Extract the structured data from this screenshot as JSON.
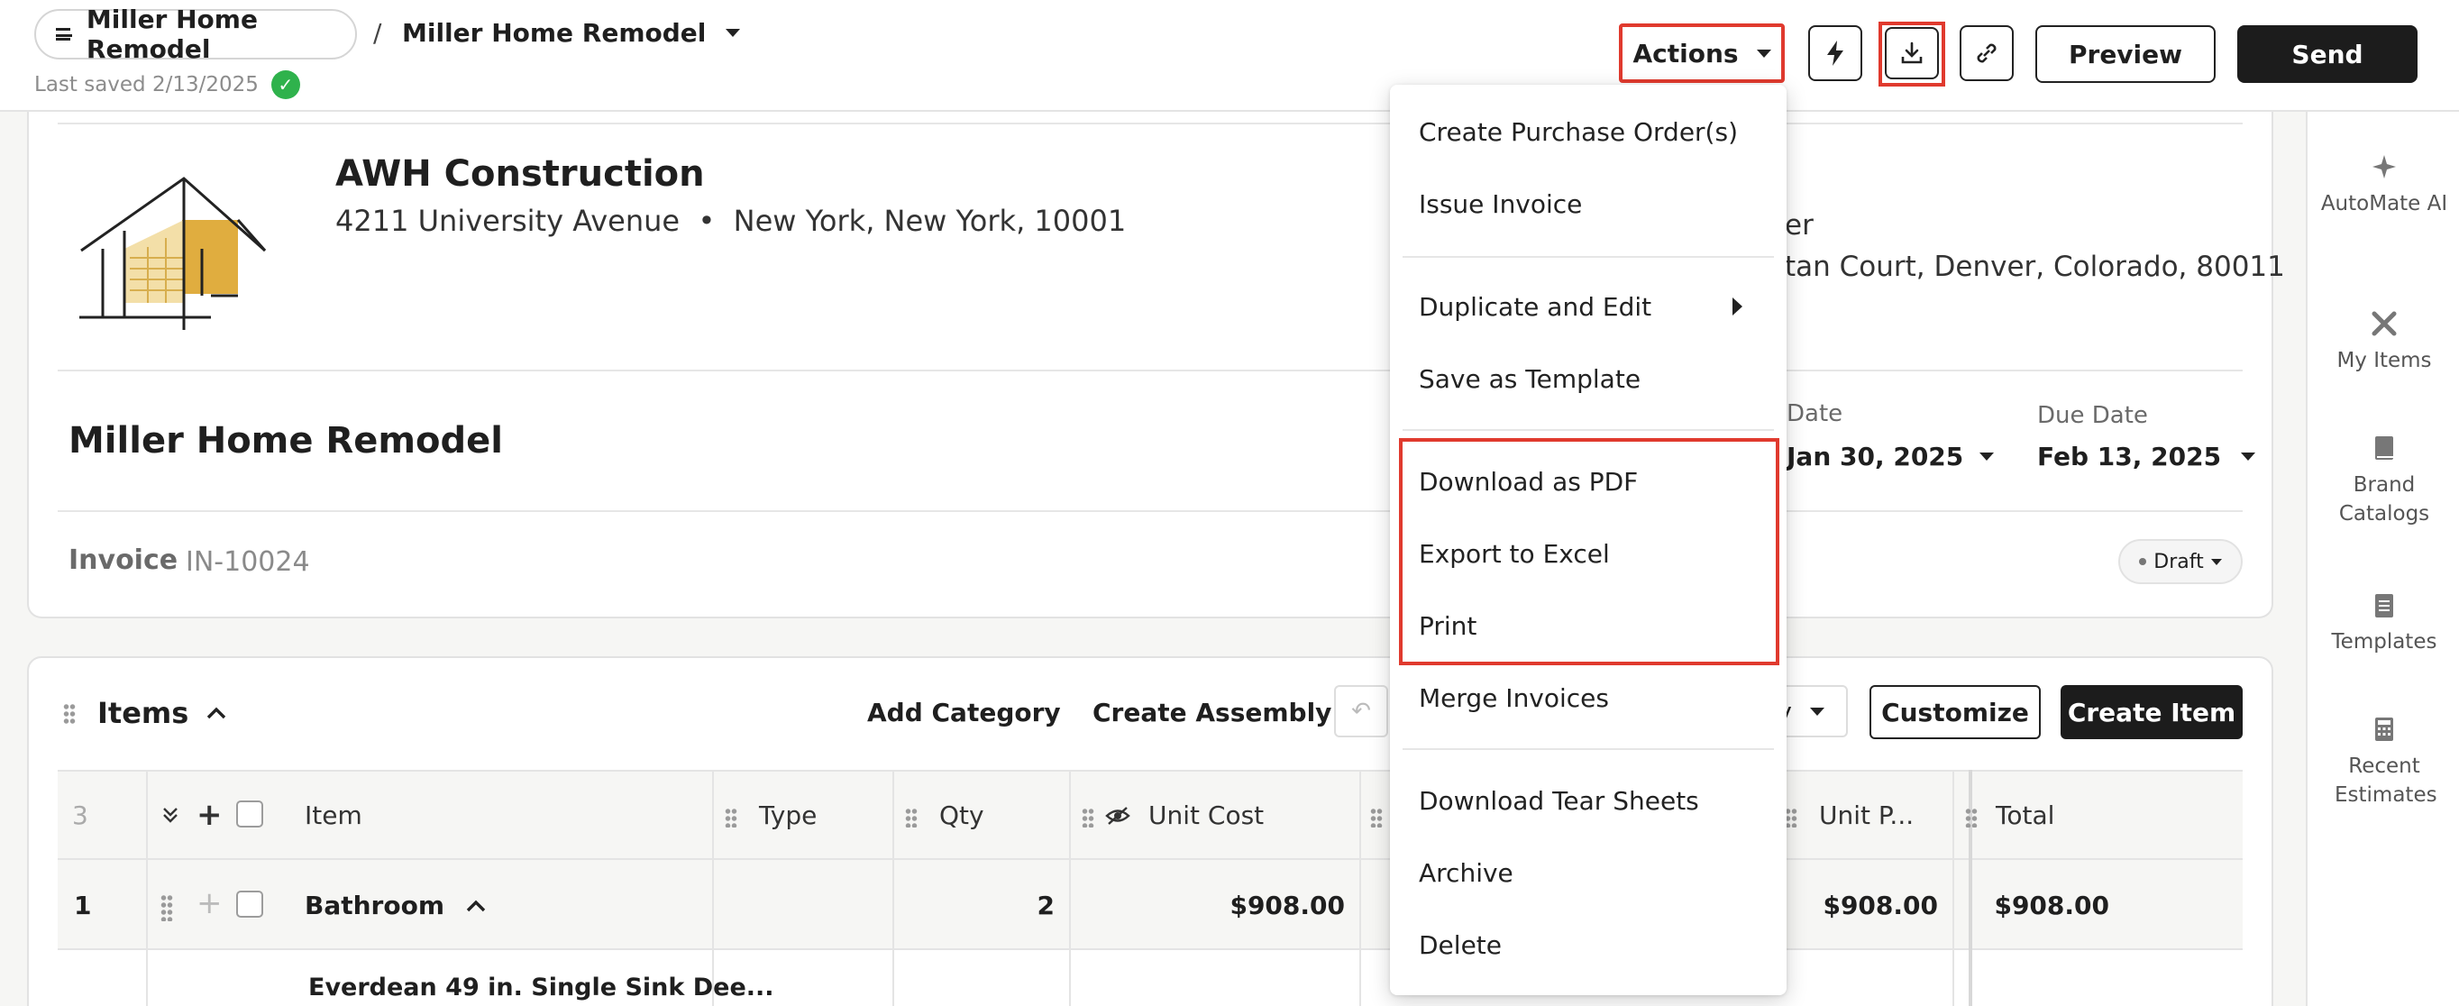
{
  "header": {
    "project_pill": "Miller Home Remodel",
    "breadcrumb_sep": "/",
    "project_title": "Miller Home Remodel",
    "last_saved": "Last saved 2/13/2025",
    "actions_label": "Actions",
    "preview_label": "Preview",
    "send_label": "Send",
    "icons": [
      "menu-icon",
      "bolt-icon",
      "download-icon",
      "link-icon",
      "check-icon"
    ]
  },
  "company": {
    "name": "AWH Construction",
    "address": "4211 University Avenue  •  New York, New York, 10001"
  },
  "client": {
    "line1": "er",
    "line2": "tan Court, Denver, Colorado, 80011"
  },
  "document": {
    "title": "Miller Home Remodel",
    "issue_date_label": "Date",
    "issue_date": "Jan 30, 2025",
    "due_date_label": "Due Date",
    "due_date": "Feb 13, 2025",
    "invoice_label": "Invoice",
    "invoice_number": "IN-10024",
    "status": "Draft"
  },
  "items": {
    "title": "Items",
    "add_category": "Add Category",
    "create_assembly": "Create Assembly",
    "undo_icon": "undo-icon",
    "view_select": "y",
    "customize": "Customize",
    "create_item": "Create Item",
    "columns": {
      "count": "3",
      "item": "Item",
      "type": "Type",
      "qty": "Qty",
      "unit_cost": "Unit Cost",
      "unit_price": "Unit P...",
      "total": "Total"
    },
    "rows": [
      {
        "num": "1",
        "item": "Bathroom",
        "qty": "2",
        "unit_cost": "$908.00",
        "unit_price": "$908.00",
        "total": "$908.00"
      },
      {
        "item": "Everdean 49 in. Single Sink Dee..."
      }
    ]
  },
  "sidebar": {
    "items": [
      {
        "label": "AutoMate AI",
        "icon": "sparkle-icon"
      },
      {
        "label": "My Items",
        "icon": "tools-icon"
      },
      {
        "label": "Brand Catalogs",
        "icon": "book-icon"
      },
      {
        "label": "Templates",
        "icon": "clipboard-icon"
      },
      {
        "label": "Recent Estimates",
        "icon": "calculator-icon"
      }
    ]
  },
  "actions_menu": {
    "items": [
      "Create Purchase Order(s)",
      "Issue Invoice",
      "Duplicate and Edit",
      "Save as Template",
      "Download as PDF",
      "Export to Excel",
      "Print",
      "Merge Invoices",
      "Download Tear Sheets",
      "Archive",
      "Delete"
    ]
  },
  "colors": {
    "highlight": "#e03a2e",
    "success": "#2fb24c",
    "primary_button": "#1c1c1c",
    "logo_gold": "#e0ad3f"
  }
}
